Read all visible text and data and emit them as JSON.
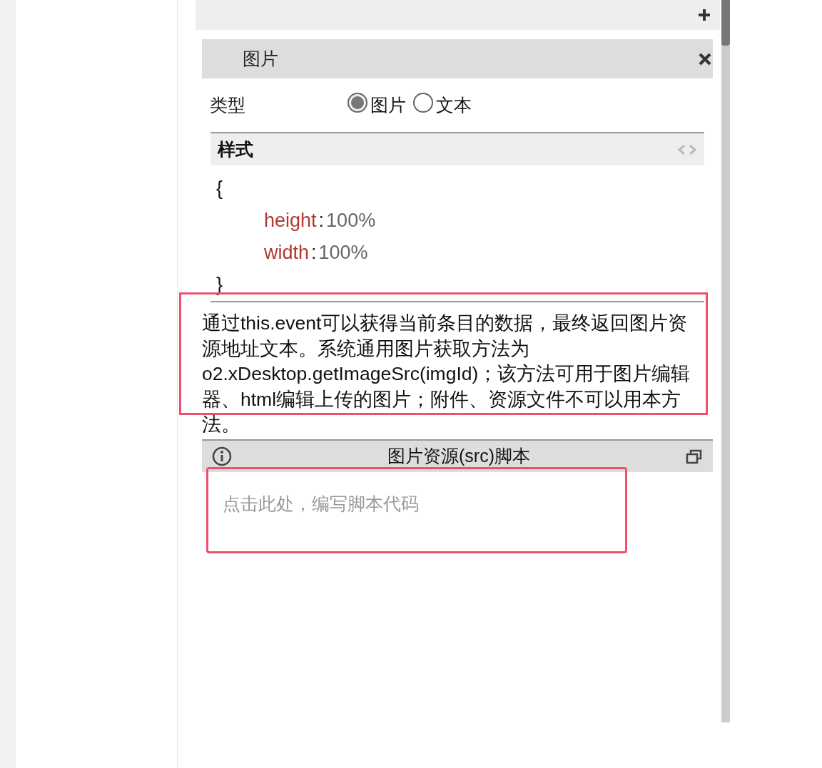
{
  "section": {
    "title": "图片"
  },
  "type_field": {
    "label": "类型",
    "options": [
      {
        "label": "图片",
        "selected": true
      },
      {
        "label": "文本",
        "selected": false
      }
    ]
  },
  "style_panel": {
    "title": "样式",
    "open_brace": "{",
    "close_brace": "}",
    "properties": [
      {
        "name": "height",
        "separator": ":",
        "value": "100%"
      },
      {
        "name": "width",
        "separator": ":",
        "value": "100%"
      }
    ]
  },
  "description": "通过this.event可以获得当前条目的数据，最终返回图片资源地址文本。系统通用图片获取方法为o2.xDesktop.getImageSrc(imgId)；该方法可用于图片编辑器、html编辑上传的图片；附件、资源文件不可以用本方法。",
  "script_panel": {
    "title": "图片资源(src)脚本",
    "placeholder": "点击此处，编写脚本代码"
  }
}
